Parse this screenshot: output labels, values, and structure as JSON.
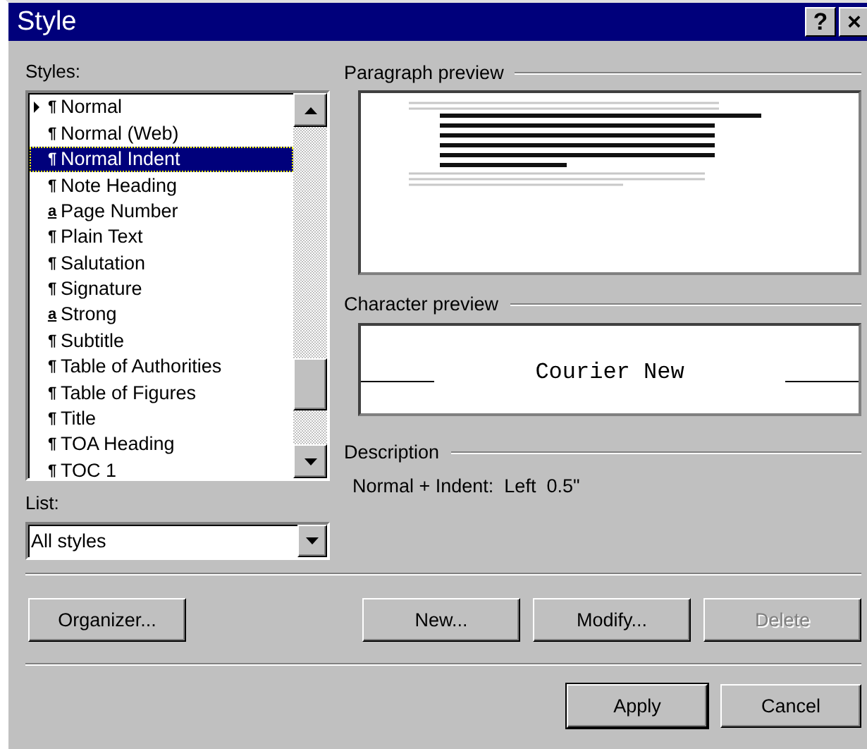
{
  "window": {
    "title": "Style",
    "help_button": "?",
    "close_button": "×"
  },
  "styles_label": "Styles:",
  "styles": [
    {
      "name": "Normal",
      "symbol": "¶",
      "kind": "paragraph",
      "current": true,
      "selected": false
    },
    {
      "name": "Normal (Web)",
      "symbol": "¶",
      "kind": "paragraph",
      "current": false,
      "selected": false
    },
    {
      "name": "Normal Indent",
      "symbol": "¶",
      "kind": "paragraph",
      "current": false,
      "selected": true
    },
    {
      "name": "Note Heading",
      "symbol": "¶",
      "kind": "paragraph",
      "current": false,
      "selected": false
    },
    {
      "name": "Page Number",
      "symbol": "a",
      "kind": "character",
      "current": false,
      "selected": false
    },
    {
      "name": "Plain Text",
      "symbol": "¶",
      "kind": "paragraph",
      "current": false,
      "selected": false
    },
    {
      "name": "Salutation",
      "symbol": "¶",
      "kind": "paragraph",
      "current": false,
      "selected": false
    },
    {
      "name": "Signature",
      "symbol": "¶",
      "kind": "paragraph",
      "current": false,
      "selected": false
    },
    {
      "name": "Strong",
      "symbol": "a",
      "kind": "character",
      "current": false,
      "selected": false
    },
    {
      "name": "Subtitle",
      "symbol": "¶",
      "kind": "paragraph",
      "current": false,
      "selected": false
    },
    {
      "name": "Table of Authorities",
      "symbol": "¶",
      "kind": "paragraph",
      "current": false,
      "selected": false
    },
    {
      "name": "Table of Figures",
      "symbol": "¶",
      "kind": "paragraph",
      "current": false,
      "selected": false
    },
    {
      "name": "Title",
      "symbol": "¶",
      "kind": "paragraph",
      "current": false,
      "selected": false
    },
    {
      "name": "TOA Heading",
      "symbol": "¶",
      "kind": "paragraph",
      "current": false,
      "selected": false
    },
    {
      "name": "TOC 1",
      "symbol": "¶",
      "kind": "paragraph",
      "current": false,
      "selected": false
    }
  ],
  "list_label": "List:",
  "list_value": "All styles",
  "paragraph_preview_label": "Paragraph preview",
  "character_preview_label": "Character preview",
  "character_preview_text": "Courier New",
  "description_label": "Description",
  "description": "Normal + Indent:  Left  0.5\"",
  "tool_buttons": [
    {
      "label": "Organizer...",
      "disabled": false
    }
  ],
  "edit_buttons": [
    {
      "label": "New...",
      "disabled": false
    },
    {
      "label": "Modify...",
      "disabled": false
    },
    {
      "label": "Delete",
      "disabled": true
    }
  ],
  "close_buttons": [
    {
      "label": "Apply",
      "disabled": false,
      "default": true
    },
    {
      "label": "Cancel",
      "disabled": false,
      "default": false
    }
  ]
}
